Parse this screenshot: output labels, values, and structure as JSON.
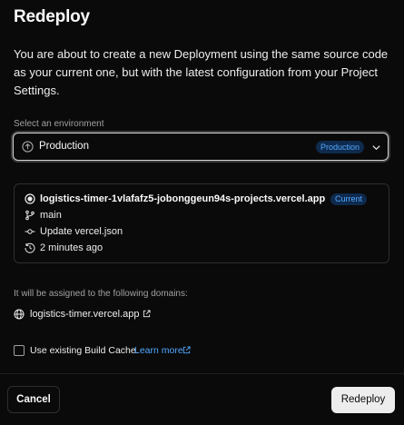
{
  "modal": {
    "title": "Redeploy",
    "description": "You are about to create a new Deployment using the same source code as your current one, but with the latest configuration from your Project Settings."
  },
  "environment": {
    "label": "Select an environment",
    "selected": "Production",
    "badge": "Production",
    "icon": "arrow-up-circle-icon"
  },
  "deployment": {
    "url": "logistics-timer-1vlafafz5-jobonggeun94s-projects.vercel.app",
    "badge": "Current",
    "branch": "main",
    "commit": "Update vercel.json",
    "time": "2 minutes ago"
  },
  "domains": {
    "label": "It will be assigned to the following domains:",
    "items": [
      "logistics-timer.vercel.app"
    ]
  },
  "cache": {
    "label": "Use existing Build Cache.",
    "link": "Learn more",
    "checked": false
  },
  "footer": {
    "cancel": "Cancel",
    "redeploy": "Redeploy"
  },
  "colors": {
    "background": "#0a0a0a",
    "badge_bg": "#0f2a4d",
    "badge_text": "#52a8ff",
    "primary_button": "#ededed"
  }
}
